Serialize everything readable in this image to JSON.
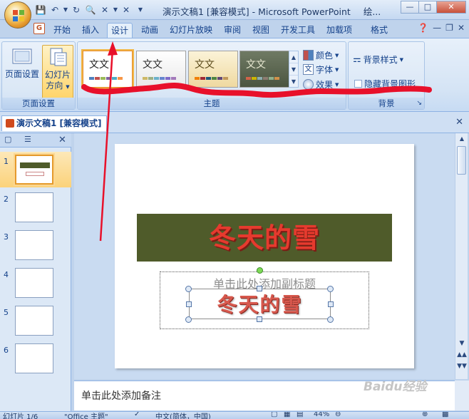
{
  "window": {
    "title": "演示文稿1 [兼容模式] - Microsoft PowerPoint",
    "title_extra": "绘..."
  },
  "ribbon": {
    "tabs": [
      {
        "label": "开始"
      },
      {
        "label": "插入"
      },
      {
        "label": "设计",
        "active": true
      },
      {
        "label": "动画"
      },
      {
        "label": "幻灯片放映"
      },
      {
        "label": "审阅"
      },
      {
        "label": "视图"
      },
      {
        "label": "开发工具"
      },
      {
        "label": "加载项"
      },
      {
        "label": "格式"
      }
    ],
    "page_setup_group": {
      "label": "页面设置",
      "page_setup_button": "页面设置",
      "orientation_button_line1": "幻灯片",
      "orientation_button_line2": "方向"
    },
    "theme_group": {
      "label": "主题",
      "theme_sample_text": "文文",
      "colors_label": "颜色",
      "fonts_label": "字体",
      "effects_label": "效果"
    },
    "background_group": {
      "label": "背景",
      "background_styles_label": "背景样式",
      "hide_background_label": "隐藏背景图形",
      "hide_background_checked": false
    }
  },
  "document_tab": {
    "label": "演示文稿1 [兼容模式]"
  },
  "slides_pane": {
    "slide_numbers": [
      "1",
      "2",
      "3",
      "4",
      "5",
      "6"
    ],
    "selected": 1
  },
  "slide": {
    "title": "冬天的雪",
    "subtitle_placeholder": "单击此处添加副标题",
    "wordart_text": "冬天的雪"
  },
  "notes": {
    "placeholder": "单击此处添加备注"
  },
  "statusbar": {
    "slide_indicator": "幻灯片 1/6",
    "theme_name": "\"Office 主题\"",
    "language": "中文(简体，中国)",
    "zoom": "44%"
  },
  "watermark": "Baidu经验",
  "colors": {
    "title_box_fill": "#4f5b2a",
    "title_text": "#e63a2e",
    "annotation_red": "#e8102a"
  }
}
